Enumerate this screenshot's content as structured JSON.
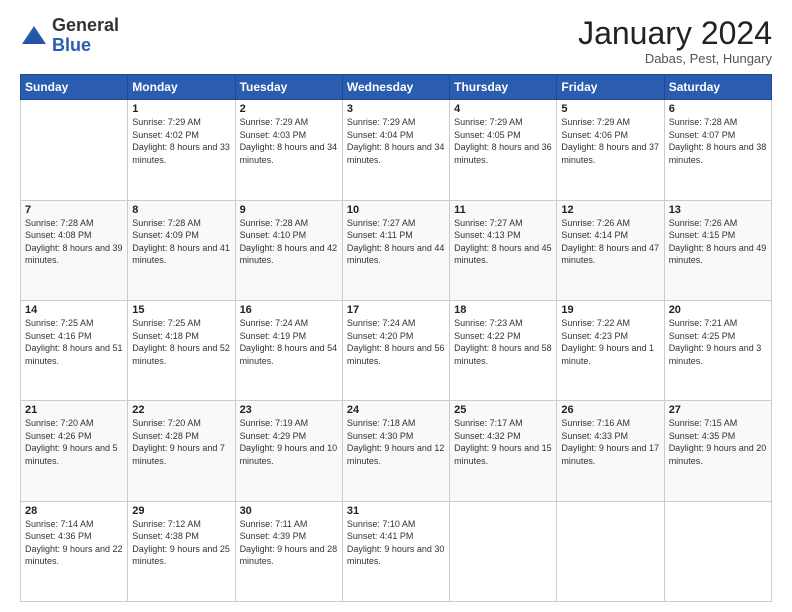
{
  "logo": {
    "general": "General",
    "blue": "Blue"
  },
  "header": {
    "month": "January 2024",
    "location": "Dabas, Pest, Hungary"
  },
  "weekdays": [
    "Sunday",
    "Monday",
    "Tuesday",
    "Wednesday",
    "Thursday",
    "Friday",
    "Saturday"
  ],
  "weeks": [
    [
      {
        "day": "",
        "sunrise": "",
        "sunset": "",
        "daylight": ""
      },
      {
        "day": "1",
        "sunrise": "7:29 AM",
        "sunset": "4:02 PM",
        "daylight": "8 hours and 33 minutes."
      },
      {
        "day": "2",
        "sunrise": "7:29 AM",
        "sunset": "4:03 PM",
        "daylight": "8 hours and 34 minutes."
      },
      {
        "day": "3",
        "sunrise": "7:29 AM",
        "sunset": "4:04 PM",
        "daylight": "8 hours and 34 minutes."
      },
      {
        "day": "4",
        "sunrise": "7:29 AM",
        "sunset": "4:05 PM",
        "daylight": "8 hours and 36 minutes."
      },
      {
        "day": "5",
        "sunrise": "7:29 AM",
        "sunset": "4:06 PM",
        "daylight": "8 hours and 37 minutes."
      },
      {
        "day": "6",
        "sunrise": "7:28 AM",
        "sunset": "4:07 PM",
        "daylight": "8 hours and 38 minutes."
      }
    ],
    [
      {
        "day": "7",
        "sunrise": "7:28 AM",
        "sunset": "4:08 PM",
        "daylight": "8 hours and 39 minutes."
      },
      {
        "day": "8",
        "sunrise": "7:28 AM",
        "sunset": "4:09 PM",
        "daylight": "8 hours and 41 minutes."
      },
      {
        "day": "9",
        "sunrise": "7:28 AM",
        "sunset": "4:10 PM",
        "daylight": "8 hours and 42 minutes."
      },
      {
        "day": "10",
        "sunrise": "7:27 AM",
        "sunset": "4:11 PM",
        "daylight": "8 hours and 44 minutes."
      },
      {
        "day": "11",
        "sunrise": "7:27 AM",
        "sunset": "4:13 PM",
        "daylight": "8 hours and 45 minutes."
      },
      {
        "day": "12",
        "sunrise": "7:26 AM",
        "sunset": "4:14 PM",
        "daylight": "8 hours and 47 minutes."
      },
      {
        "day": "13",
        "sunrise": "7:26 AM",
        "sunset": "4:15 PM",
        "daylight": "8 hours and 49 minutes."
      }
    ],
    [
      {
        "day": "14",
        "sunrise": "7:25 AM",
        "sunset": "4:16 PM",
        "daylight": "8 hours and 51 minutes."
      },
      {
        "day": "15",
        "sunrise": "7:25 AM",
        "sunset": "4:18 PM",
        "daylight": "8 hours and 52 minutes."
      },
      {
        "day": "16",
        "sunrise": "7:24 AM",
        "sunset": "4:19 PM",
        "daylight": "8 hours and 54 minutes."
      },
      {
        "day": "17",
        "sunrise": "7:24 AM",
        "sunset": "4:20 PM",
        "daylight": "8 hours and 56 minutes."
      },
      {
        "day": "18",
        "sunrise": "7:23 AM",
        "sunset": "4:22 PM",
        "daylight": "8 hours and 58 minutes."
      },
      {
        "day": "19",
        "sunrise": "7:22 AM",
        "sunset": "4:23 PM",
        "daylight": "9 hours and 1 minute."
      },
      {
        "day": "20",
        "sunrise": "7:21 AM",
        "sunset": "4:25 PM",
        "daylight": "9 hours and 3 minutes."
      }
    ],
    [
      {
        "day": "21",
        "sunrise": "7:20 AM",
        "sunset": "4:26 PM",
        "daylight": "9 hours and 5 minutes."
      },
      {
        "day": "22",
        "sunrise": "7:20 AM",
        "sunset": "4:28 PM",
        "daylight": "9 hours and 7 minutes."
      },
      {
        "day": "23",
        "sunrise": "7:19 AM",
        "sunset": "4:29 PM",
        "daylight": "9 hours and 10 minutes."
      },
      {
        "day": "24",
        "sunrise": "7:18 AM",
        "sunset": "4:30 PM",
        "daylight": "9 hours and 12 minutes."
      },
      {
        "day": "25",
        "sunrise": "7:17 AM",
        "sunset": "4:32 PM",
        "daylight": "9 hours and 15 minutes."
      },
      {
        "day": "26",
        "sunrise": "7:16 AM",
        "sunset": "4:33 PM",
        "daylight": "9 hours and 17 minutes."
      },
      {
        "day": "27",
        "sunrise": "7:15 AM",
        "sunset": "4:35 PM",
        "daylight": "9 hours and 20 minutes."
      }
    ],
    [
      {
        "day": "28",
        "sunrise": "7:14 AM",
        "sunset": "4:36 PM",
        "daylight": "9 hours and 22 minutes."
      },
      {
        "day": "29",
        "sunrise": "7:12 AM",
        "sunset": "4:38 PM",
        "daylight": "9 hours and 25 minutes."
      },
      {
        "day": "30",
        "sunrise": "7:11 AM",
        "sunset": "4:39 PM",
        "daylight": "9 hours and 28 minutes."
      },
      {
        "day": "31",
        "sunrise": "7:10 AM",
        "sunset": "4:41 PM",
        "daylight": "9 hours and 30 minutes."
      },
      {
        "day": "",
        "sunrise": "",
        "sunset": "",
        "daylight": ""
      },
      {
        "day": "",
        "sunrise": "",
        "sunset": "",
        "daylight": ""
      },
      {
        "day": "",
        "sunrise": "",
        "sunset": "",
        "daylight": ""
      }
    ]
  ]
}
